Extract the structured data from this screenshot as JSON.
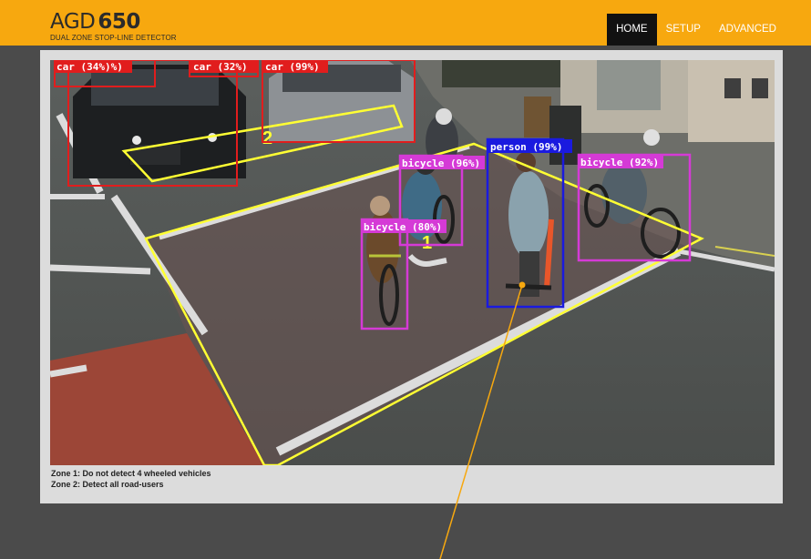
{
  "header": {
    "brand_prefix": "AGD",
    "brand_model": "650",
    "brand_subtitle": "DUAL ZONE STOP-LINE DETECTOR"
  },
  "nav": {
    "items": [
      {
        "label": "HOME",
        "active": true
      },
      {
        "label": "SETUP",
        "active": false
      },
      {
        "label": "ADVANCED",
        "active": false
      }
    ]
  },
  "detections": [
    {
      "label": "car (34%)%)",
      "class": "car",
      "color": "#e11d1d"
    },
    {
      "label": "car (32%)",
      "class": "car",
      "color": "#e11d1d"
    },
    {
      "label": "car (99%)",
      "class": "car",
      "color": "#e11d1d"
    },
    {
      "label": "person (99%)",
      "class": "person",
      "color": "#1a1adf"
    },
    {
      "label": "bicycle (96%)",
      "class": "bicycle",
      "color": "#d53ad6"
    },
    {
      "label": "bicycle (92%)",
      "class": "bicycle",
      "color": "#d53ad6"
    },
    {
      "label": "bicycle (80%)",
      "class": "bicycle",
      "color": "#d53ad6"
    }
  ],
  "zones": {
    "zone1_number": "1",
    "zone2_number": "2",
    "zone_color": "#ffff33"
  },
  "notes": {
    "zone1": "Zone 1: Do not detect 4 wheeled vehicles",
    "zone2": "Zone 2: Detect all road-users"
  },
  "colors": {
    "accent": "#f7a80f",
    "nav_active": "#111111",
    "pointer": "#f7a80f"
  }
}
